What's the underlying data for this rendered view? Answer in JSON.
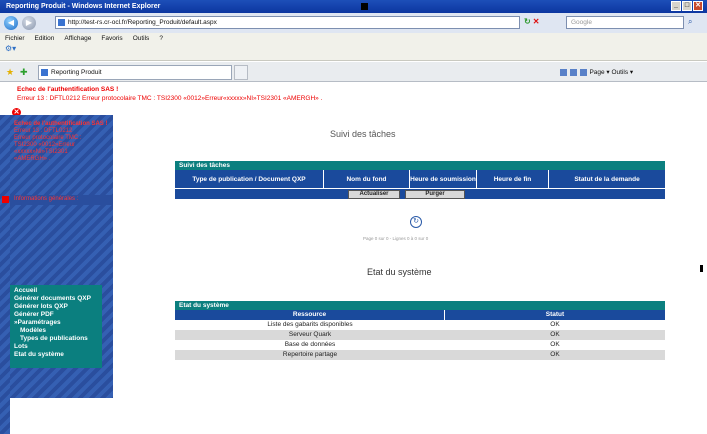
{
  "window": {
    "title": "Reporting Produit - Windows Internet Explorer",
    "controls": [
      "_",
      "□",
      "✕"
    ]
  },
  "browser": {
    "address": "http://test-rs.cr-ocl.fr/Reporting_Produit/default.aspx",
    "search_placeholder": "Google",
    "menu": [
      "Fichier",
      "Edition",
      "Affichage",
      "Favoris",
      "Outils",
      "?"
    ],
    "tab_label": "Reporting Produit",
    "command_bar": "Page ▾   Outils ▾"
  },
  "errors": {
    "line1": "Echec de l'authentification SAS !",
    "line2": "Erreur 13 : DFTL0212 Erreur protocolaire TMC : TSI2300 «0012»Erreur«xxxxx»NI»TSI2301 «AMERGH» .",
    "side_title": "Echec de l'authentification SAS !",
    "side_lines": [
      "Erreur 13 : DFTL0212",
      "Erreur protocolaire TMC :",
      "TSI2300 «0012»Erreur",
      "«xxxxx»NI»TSI2301",
      "«AMERGH» ."
    ],
    "side_focus": "Informations générales :"
  },
  "nav": [
    {
      "label": "Accueil",
      "sub": false
    },
    {
      "label": "Générer documents QXP",
      "sub": false
    },
    {
      "label": "Générer lots QXP",
      "sub": false
    },
    {
      "label": "Générer PDF",
      "sub": false
    },
    {
      "label": "»Paramétrages",
      "sub": false
    },
    {
      "label": "Modèles",
      "sub": true
    },
    {
      "label": "Types de publications",
      "sub": true
    },
    {
      "label": "Lots",
      "sub": false
    },
    {
      "label": "Etat du système",
      "sub": false
    }
  ],
  "tasks": {
    "section_title": "Suivi des tâches",
    "caption": "Suivi des tâches",
    "columns": [
      "Type de publication / Document QXP",
      "Nom du fond",
      "Heure de soumission",
      "Heure de fin",
      "Statut de la demande"
    ],
    "btn_refresh": "Actualiser",
    "btn_purge": "Purger",
    "page_info": "Page 0 sur 0 - Lignes 0 à 0 sur 0"
  },
  "system": {
    "section_title": "Etat du système",
    "caption": "Etat du système",
    "columns": [
      "Ressource",
      "Statut"
    ],
    "rows": [
      {
        "resource": "Liste des gabarits disponibles",
        "status": "OK"
      },
      {
        "resource": "Serveur Quark",
        "status": "OK"
      },
      {
        "resource": "Base de données",
        "status": "OK"
      },
      {
        "resource": "Repertoire partage",
        "status": "OK"
      }
    ]
  }
}
